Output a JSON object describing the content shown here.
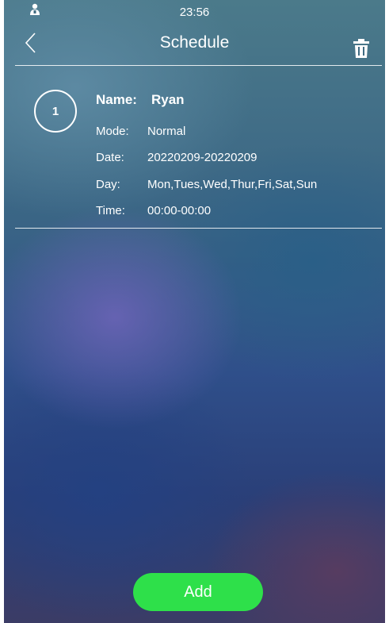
{
  "status_bar": {
    "time": "23:56",
    "user_icon": "user-badge-icon"
  },
  "header": {
    "title": "Schedule",
    "back_icon": "chevron-left-icon",
    "delete_icon": "trash-icon"
  },
  "schedules": [
    {
      "index": "1",
      "name_label": "Name:",
      "name": "Ryan",
      "mode_label": "Mode:",
      "mode": "Normal",
      "date_label": "Date:",
      "date": "20220209-20220209",
      "day_label": "Day:",
      "day": "Mon,Tues,Wed,Thur,Fri,Sat,Sun",
      "time_label": "Time:",
      "time": "00:00-00:00"
    }
  ],
  "footer": {
    "add_label": "Add"
  },
  "colors": {
    "add_button": "#2ee04a",
    "text": "#ffffff"
  }
}
